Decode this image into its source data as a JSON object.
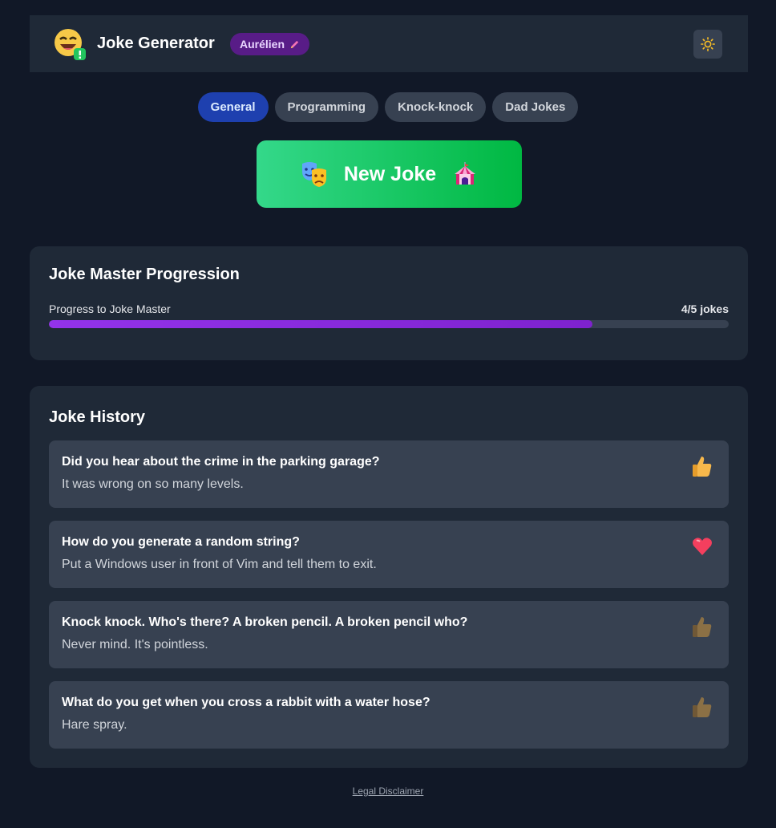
{
  "header": {
    "title": "Joke Generator",
    "user_name": "Aurélien",
    "logo_icon": "laughing-face-icon",
    "edit_icon": "pencil-icon",
    "theme_icon": "sun-icon"
  },
  "tabs": [
    {
      "label": "General",
      "active": true
    },
    {
      "label": "Programming",
      "active": false
    },
    {
      "label": "Knock-knock",
      "active": false
    },
    {
      "label": "Dad Jokes",
      "active": false
    }
  ],
  "new_joke": {
    "label": "New Joke",
    "left_icon": "theater-masks-icon",
    "right_icon": "circus-tent-icon"
  },
  "progress": {
    "title": "Joke Master Progression",
    "label": "Progress to Joke Master",
    "count_text": "4/5 jokes",
    "value": 4,
    "max": 5
  },
  "history": {
    "title": "Joke History",
    "items": [
      {
        "setup": "Did you hear about the crime in the parking garage?",
        "punchline": "It was wrong on so many levels.",
        "reaction": "thumbs-up-icon"
      },
      {
        "setup": "How do you generate a random string?",
        "punchline": "Put a Windows user in front of Vim and tell them to exit.",
        "reaction": "heart-icon"
      },
      {
        "setup": "Knock knock. Who's there? A broken pencil. A broken pencil who?",
        "punchline": "Never mind. It's pointless.",
        "reaction": "thumbs-up-dim-icon"
      },
      {
        "setup": "What do you get when you cross a rabbit with a water hose?",
        "punchline": "Hare spray.",
        "reaction": "thumbs-up-dim-icon"
      }
    ]
  },
  "footer": {
    "link": "Legal Disclaimer"
  },
  "colors": {
    "background": "#111827",
    "card": "#1f2937",
    "item": "#374151",
    "accent_blue": "#1e40af",
    "accent_green": "#00b842",
    "accent_purple": "#9333ea"
  }
}
